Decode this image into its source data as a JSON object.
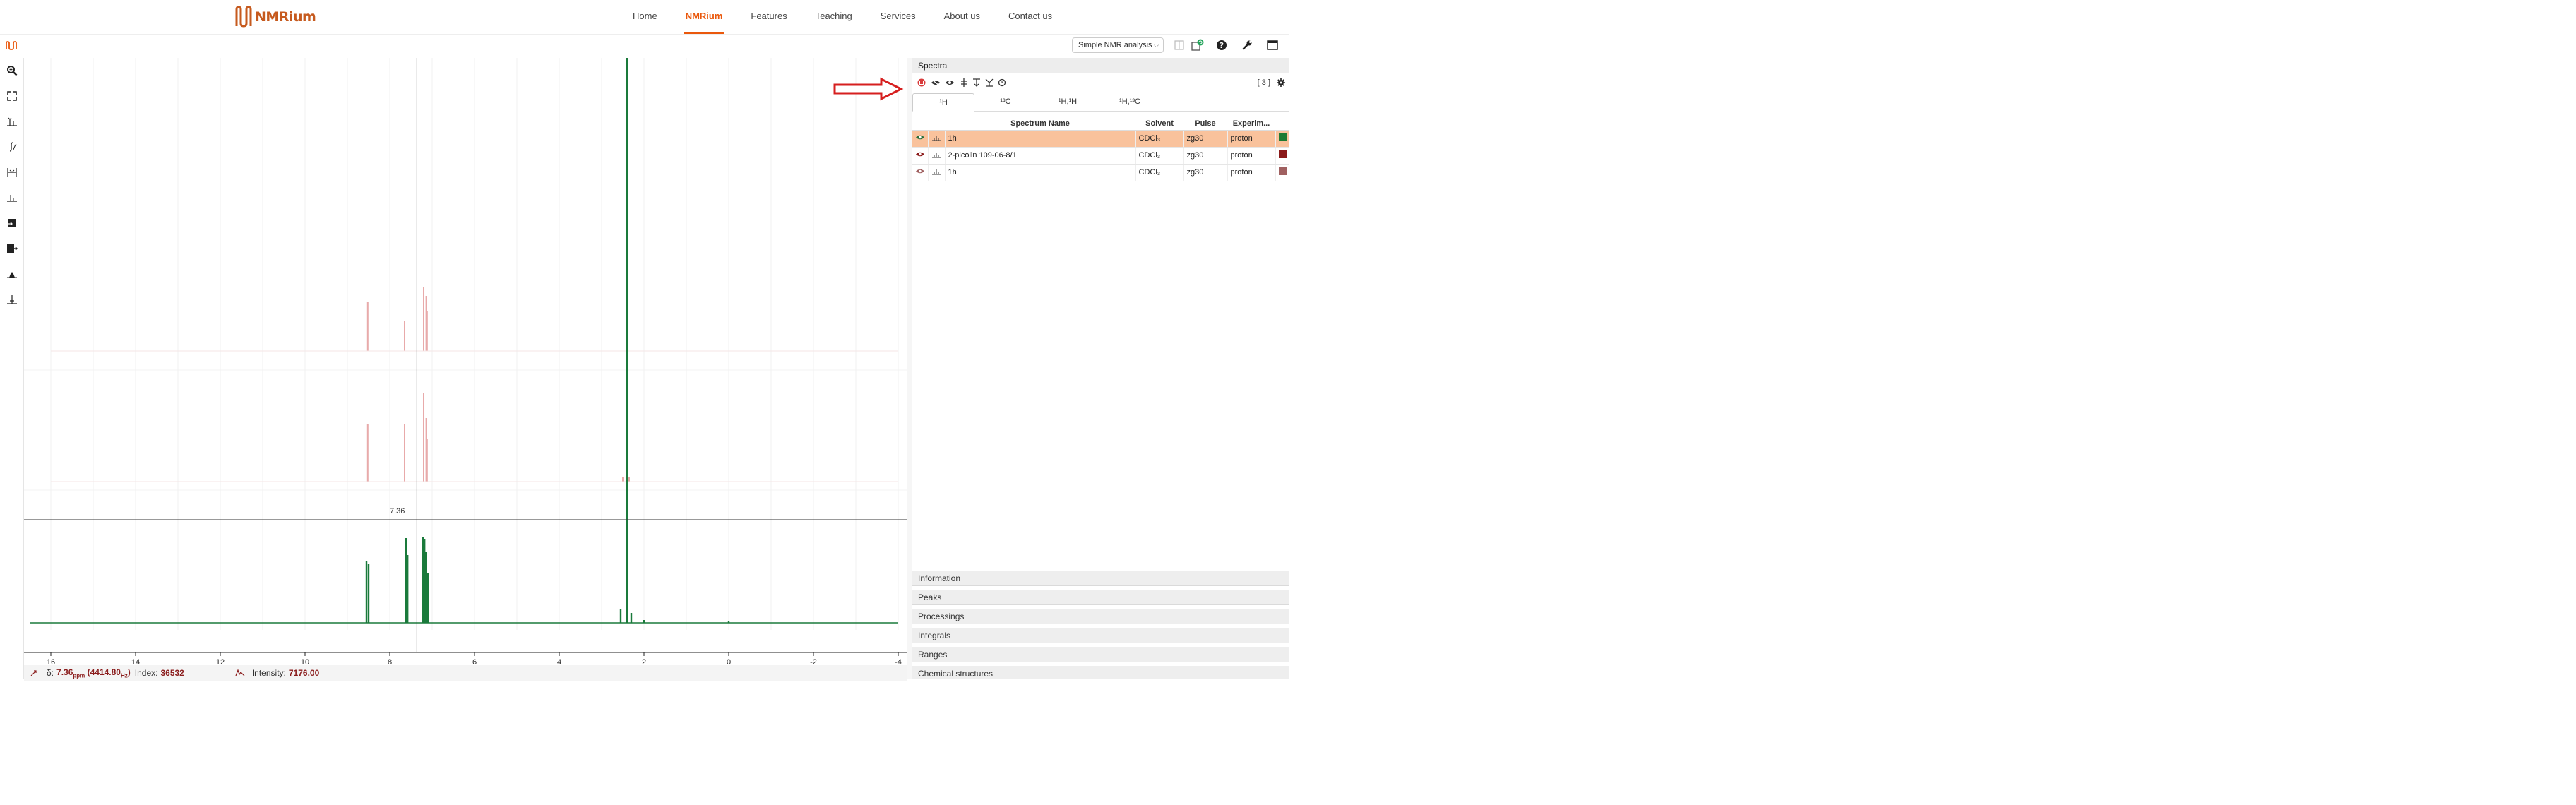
{
  "brand": {
    "name": "NMRium",
    "accent": "#ea580c"
  },
  "nav": {
    "links": [
      {
        "label": "Home"
      },
      {
        "label": "NMRium"
      },
      {
        "label": "Features"
      },
      {
        "label": "Teaching"
      },
      {
        "label": "Services"
      },
      {
        "label": "About us"
      },
      {
        "label": "Contact us"
      }
    ],
    "active": "NMRium"
  },
  "topbar": {
    "workspace": "Simple NMR analysis",
    "icons": [
      "spectra-grid-icon",
      "refresh-icon",
      "help-icon",
      "settings-wrench-icon",
      "window-icon"
    ]
  },
  "left_toolbar": {
    "tools": [
      "zoom-icon",
      "fullscreen-icon",
      "peak-picking-icon",
      "integral-icon",
      "ranges-icon",
      "baseline-icon",
      "phase-icon",
      "export-icon",
      "multiplet-icon",
      "slice-icon"
    ]
  },
  "spectrum": {
    "x_ticks": [
      "16",
      "14",
      "12",
      "10",
      "8",
      "6",
      "4",
      "2",
      "0",
      "-2",
      "-4"
    ],
    "crosshair_label": "7.36",
    "colors": {
      "main": "#1a7a3b",
      "faded": "#e8aaaa"
    }
  },
  "status": {
    "delta": "7.36",
    "delta_unit": "ppm",
    "hz": "(4414.80",
    "hz_unit": "Hz",
    "hz_close": ")",
    "index_label": "Index:",
    "index": "36532",
    "intensity_label": "Intensity:",
    "intensity": "7176.00"
  },
  "panel": {
    "title": "Spectra",
    "count": "[ 3 ]",
    "tabs": [
      "¹H",
      "¹³C",
      "¹H,¹H",
      "¹H,¹³C"
    ],
    "columns": [
      "",
      "",
      "Spectrum Name",
      "Solvent",
      "Pulse",
      "Experim...",
      ""
    ],
    "rows": [
      {
        "name": "1h",
        "solvent": "CDCl₃",
        "pulse": "zg30",
        "experiment": "proton",
        "color": "#1e7a33",
        "selected": true
      },
      {
        "name": "2-picolin 109-06-8/1",
        "solvent": "CDCl₃",
        "pulse": "zg30",
        "experiment": "proton",
        "color": "#8b1a1a",
        "selected": false
      },
      {
        "name": "1h",
        "solvent": "CDCl₃",
        "pulse": "zg30",
        "experiment": "proton",
        "color": "#a06060",
        "selected": false
      }
    ],
    "sections": [
      "Information",
      "Peaks",
      "Processings",
      "Integrals",
      "Ranges",
      "Chemical structures"
    ]
  }
}
